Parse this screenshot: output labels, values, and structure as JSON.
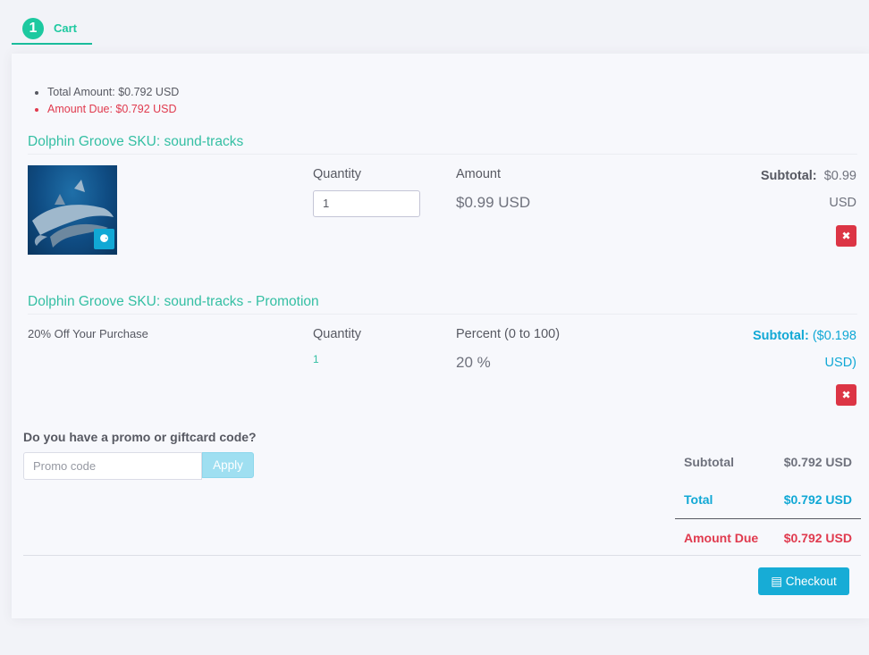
{
  "tab": {
    "number": "1",
    "label": "Cart"
  },
  "summary": {
    "total_amount": "Total Amount: $0.792 USD",
    "amount_due": "Amount Due: $0.792 USD"
  },
  "items": [
    {
      "title": "Dolphin Groove SKU: sound-tracks",
      "quantity_label": "Quantity",
      "quantity_value": "1",
      "amount_label": "Amount",
      "amount_value": "$0.99 USD",
      "subtotal_label": "Subtotal:",
      "subtotal_value": "$0.99",
      "subtotal_currency": "USD"
    },
    {
      "title": "Dolphin Groove SKU: sound-tracks - Promotion",
      "description": "20% Off Your Purchase",
      "quantity_label": "Quantity",
      "quantity_value": "1",
      "amount_label": "Percent (0 to 100)",
      "amount_value": "20 %",
      "subtotal_label": "Subtotal:",
      "subtotal_value": "($0.198",
      "subtotal_currency": "USD)"
    }
  ],
  "promo": {
    "question": "Do you have a promo or giftcard code?",
    "placeholder": "Promo code",
    "apply_label": "Apply"
  },
  "totals": {
    "subtotal_label": "Subtotal",
    "subtotal_value": "$0.792 USD",
    "total_label": "Total",
    "total_value": "$0.792 USD",
    "due_label": "Amount Due",
    "due_value": "$0.792 USD"
  },
  "checkout_label": "Checkout",
  "colors": {
    "accent": "#1dc9a0",
    "info": "#11a8d5",
    "danger": "#dc3545"
  }
}
